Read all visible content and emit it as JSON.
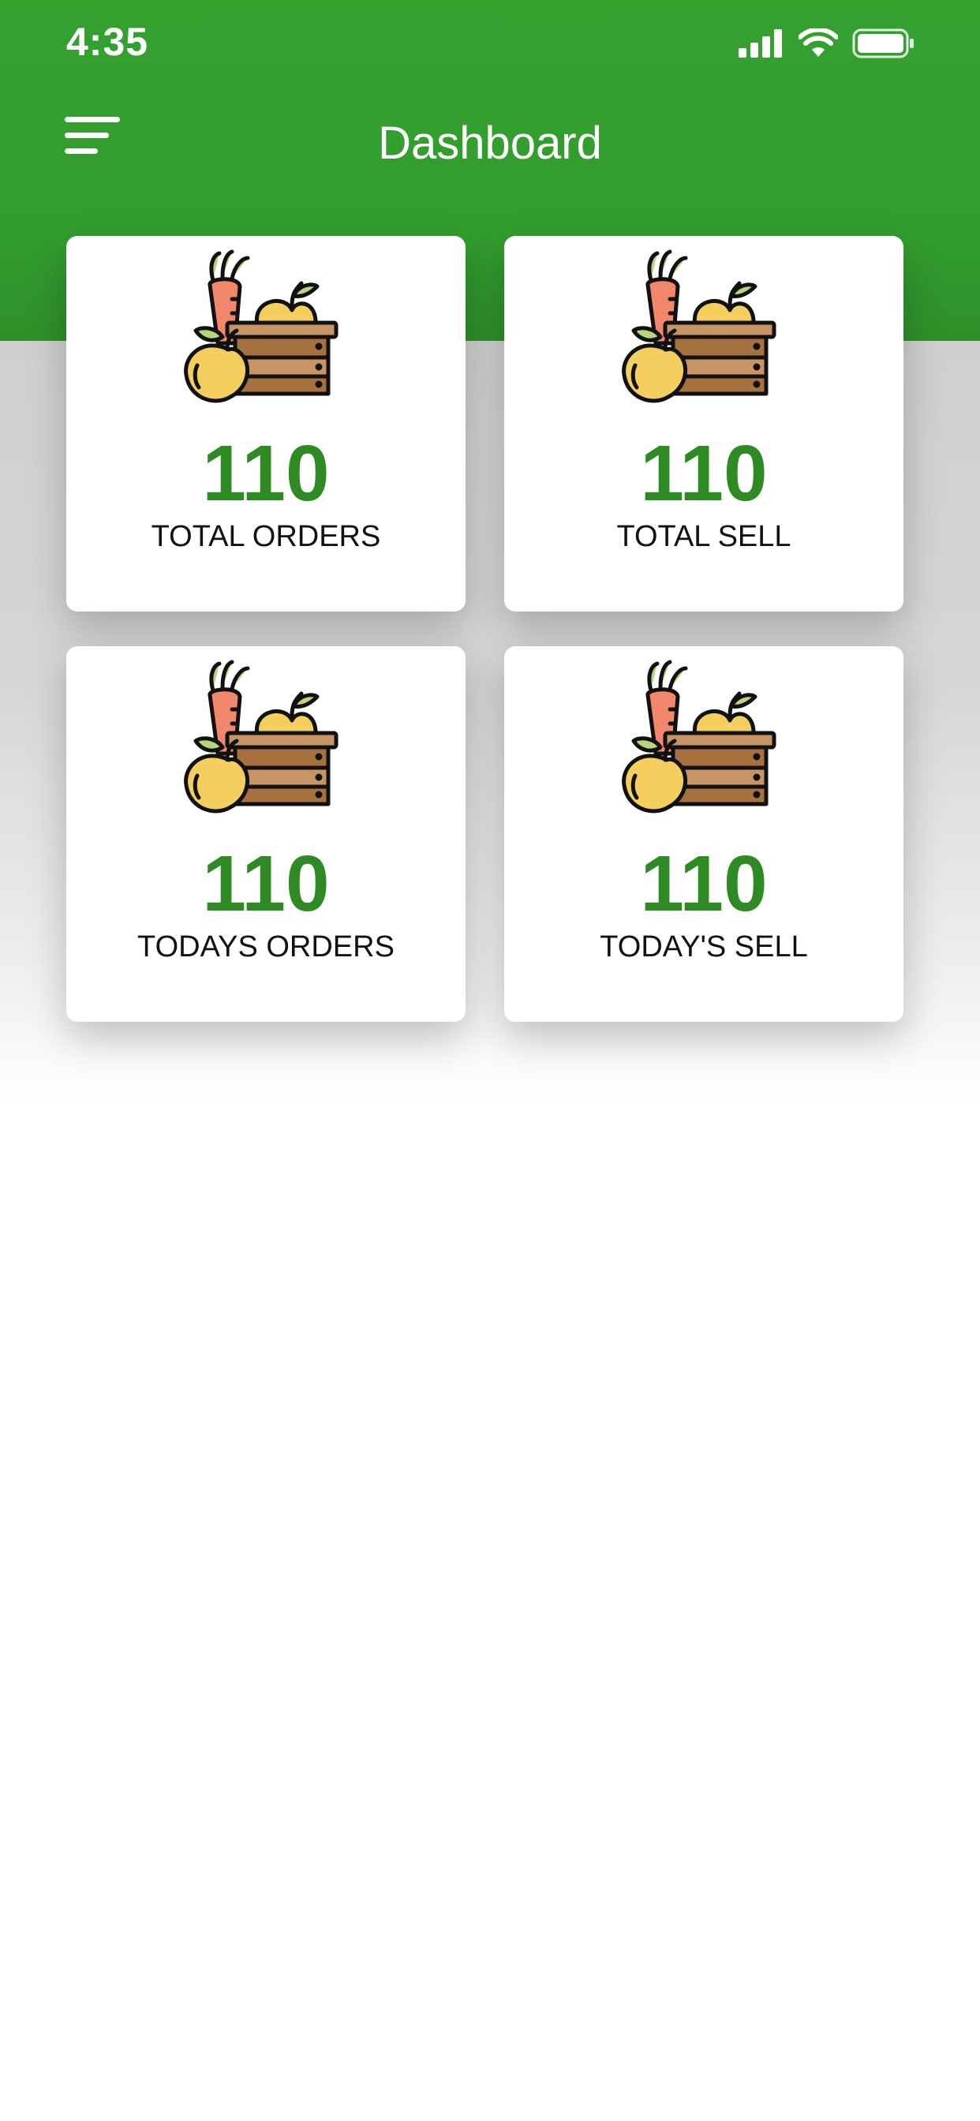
{
  "status_bar": {
    "time": "4:35",
    "icons": [
      "cellular-signal-icon",
      "wifi-icon",
      "battery-icon"
    ]
  },
  "header": {
    "title": "Dashboard",
    "menu_icon": "hamburger-menu-icon",
    "background_color": "#34a12f"
  },
  "cards": [
    {
      "value": "110",
      "label": "TOTAL ORDERS",
      "icon": "produce-crate-icon"
    },
    {
      "value": "110",
      "label": "TOTAL SELL",
      "icon": "produce-crate-icon"
    },
    {
      "value": "110",
      "label": "TODAYS ORDERS",
      "icon": "produce-crate-icon"
    },
    {
      "value": "110",
      "label": "TODAY'S SELL",
      "icon": "produce-crate-icon"
    }
  ],
  "colors": {
    "accent_green": "#34a12f",
    "value_green": "#2e8b24"
  }
}
